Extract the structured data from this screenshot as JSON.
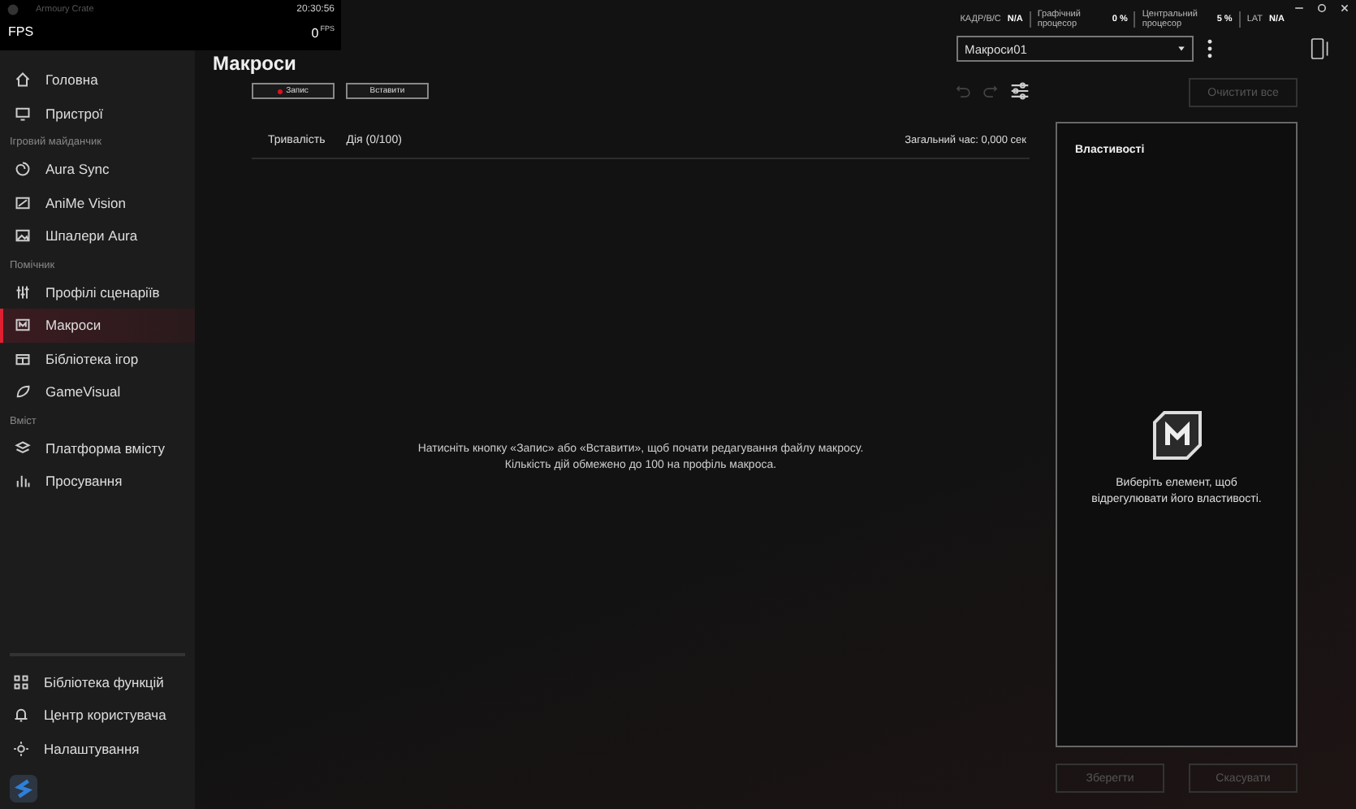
{
  "overlay": {
    "app_name": "Armoury Crate",
    "time": "20:30:56",
    "label": "FPS",
    "value": "0",
    "unit": "FPS"
  },
  "sidebar": {
    "sections": [
      {
        "items": [
          {
            "label": "Головна",
            "selected": false
          },
          {
            "label": "Пристрої",
            "selected": false
          }
        ]
      },
      {
        "title": "Ігровий майданчик",
        "items": [
          {
            "label": "Aura Sync",
            "selected": false
          },
          {
            "label": "AniMe Vision",
            "selected": false
          },
          {
            "label": "Шпалери Aura",
            "selected": false
          }
        ]
      },
      {
        "title": "Помічник",
        "items": [
          {
            "label": "Профілі сценаріїв",
            "selected": false
          },
          {
            "label": "Макроси",
            "selected": true
          },
          {
            "label": "Бібліотека ігор",
            "selected": false
          },
          {
            "label": "GameVisual",
            "selected": false
          }
        ]
      },
      {
        "title": "Вміст",
        "items": [
          {
            "label": "Платформа вмісту",
            "selected": false
          },
          {
            "label": "Просування",
            "selected": false
          }
        ]
      }
    ],
    "bottom_items": [
      {
        "label": "Бібліотека функцій"
      },
      {
        "label": "Центр користувача"
      },
      {
        "label": "Налаштування"
      }
    ]
  },
  "page_title": "Макроси",
  "stats": [
    {
      "label": "КАДР/В/С",
      "value": "N/A"
    },
    {
      "label": "Графічний процесор",
      "value": "0 %"
    },
    {
      "label": "Центральний процесор",
      "value": "5 %"
    },
    {
      "label": "LAT",
      "value": "N/A"
    }
  ],
  "profile_dropdown": {
    "value": "Макроси01"
  },
  "toolbar": {
    "buttons": [
      {
        "label": "Запис",
        "kind": "record",
        "disabled": false
      },
      {
        "label": "Вставити",
        "kind": "plain",
        "disabled": false
      }
    ],
    "clear_button": {
      "label": "Очистити все",
      "disabled": true
    }
  },
  "table": {
    "columns": [
      "Тривалість",
      "Дія (0/100)"
    ],
    "total": "Загальний час: 0,000 сек",
    "empty_message": [
      "Натисніть кнопку «Запис» або «Вставити», щоб почати редагування файлу макросу.",
      "Кількість дій обмежено до 100 на профіль макроса."
    ]
  },
  "properties": {
    "title": "Властивості",
    "hint": [
      "Виберіть елемент, щоб",
      "відрегулювати його властивості."
    ]
  },
  "footer_buttons": [
    {
      "label": "Зберегти",
      "disabled": true
    },
    {
      "label": "Скасувати",
      "disabled": true
    }
  ]
}
